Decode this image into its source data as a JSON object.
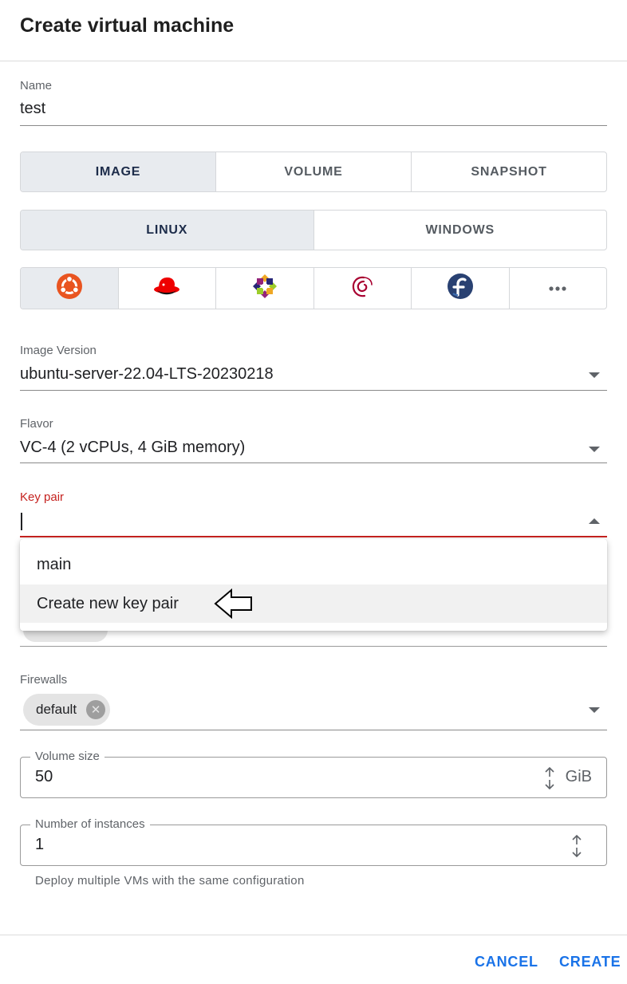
{
  "dialog": {
    "title": "Create virtual machine"
  },
  "name_field": {
    "label": "Name",
    "value": "test"
  },
  "source_tabs": [
    {
      "label": "IMAGE",
      "selected": true
    },
    {
      "label": "VOLUME",
      "selected": false
    },
    {
      "label": "SNAPSHOT",
      "selected": false
    }
  ],
  "os_tabs": [
    {
      "label": "LINUX",
      "selected": true
    },
    {
      "label": "WINDOWS",
      "selected": false
    }
  ],
  "distro_buttons": [
    {
      "icon": "ubuntu-icon",
      "selected": true
    },
    {
      "icon": "redhat-icon",
      "selected": false
    },
    {
      "icon": "centos-icon",
      "selected": false
    },
    {
      "icon": "debian-icon",
      "selected": false
    },
    {
      "icon": "fedora-icon",
      "selected": false
    },
    {
      "icon": "more-icon",
      "selected": false
    }
  ],
  "image_version": {
    "label": "Image Version",
    "value": "ubuntu-server-22.04-LTS-20230218"
  },
  "flavor": {
    "label": "Flavor",
    "value": "VC-4 (2 vCPUs, 4 GiB memory)"
  },
  "key_pair": {
    "label": "Key pair",
    "value": "",
    "options": [
      "main",
      "Create new key pair"
    ],
    "highlighted_index": 1
  },
  "firewalls": {
    "label": "Firewalls",
    "chips": [
      "default"
    ]
  },
  "volume_size": {
    "label": "Volume size",
    "value": "50",
    "unit": "GiB"
  },
  "instances": {
    "label": "Number of instances",
    "value": "1",
    "helper": "Deploy multiple VMs with the same configuration"
  },
  "actions": {
    "cancel": "CANCEL",
    "create": "CREATE"
  },
  "colors": {
    "accent": "#1a73e8",
    "error": "#c5221f",
    "selected_segment": "#e8ebef"
  }
}
